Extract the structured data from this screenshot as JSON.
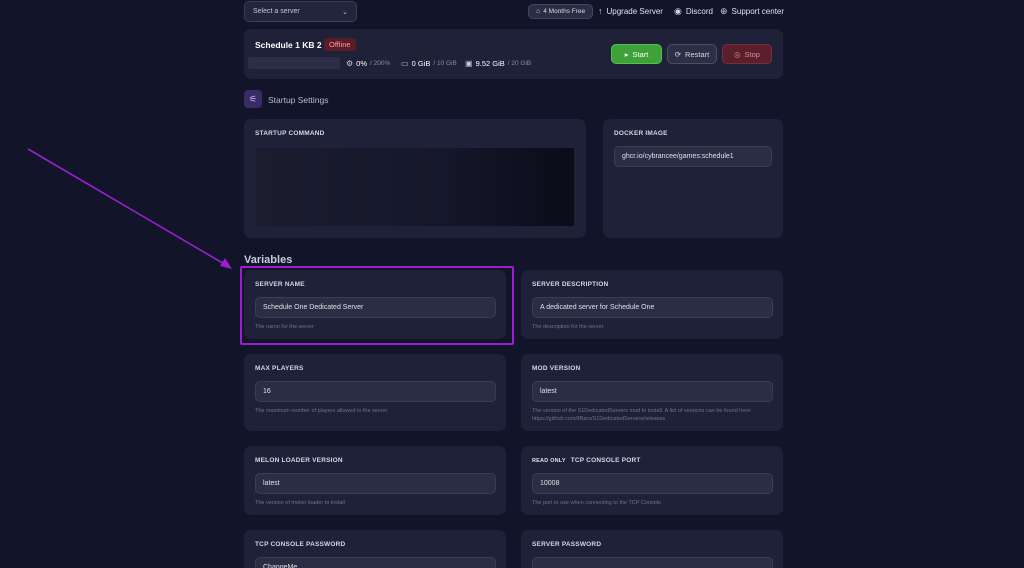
{
  "topbar": {
    "server_select_placeholder": "Select a server",
    "free_pill": "4 Months Free",
    "upgrade": "Upgrade Server",
    "discord": "Discord",
    "support": "Support center"
  },
  "status": {
    "server_name": "Schedule 1 KB 2",
    "state": "Offline",
    "cpu_value": "0%",
    "cpu_limit": "/ 200%",
    "memory_value": "0 GiB",
    "memory_limit": "/ 10 GiB",
    "disk_value": "9.52 GiB",
    "disk_limit": "/ 20 GiB",
    "start_label": "Start",
    "restart_label": "Restart",
    "stop_label": "Stop"
  },
  "startup": {
    "title": "Startup Settings",
    "command_label": "STARTUP COMMAND",
    "docker_label": "DOCKER IMAGE",
    "docker_value": "ghcr.io/cybrancee/games:schedule1"
  },
  "variables": {
    "title": "Variables",
    "server_name": {
      "label": "SERVER NAME",
      "value": "Schedule One Dedicated Server",
      "help": "The name for the server"
    },
    "server_description": {
      "label": "SERVER DESCRIPTION",
      "value": "A dedicated server for Schedule One",
      "help": "The description for the server"
    },
    "max_players": {
      "label": "MAX PLAYERS",
      "value": "16",
      "help": "The maximum number of players allowed in the server"
    },
    "mod_version": {
      "label": "MOD VERSION",
      "value": "latest",
      "help": "The version of the S1DedicatedServers mod to install. A list of versions can be found here: https://github.com/ifBars/S1DedicatedServers/releases"
    },
    "melon_loader": {
      "label": "MELON LOADER VERSION",
      "value": "latest",
      "help": "The version of melon loader to install"
    },
    "tcp_port": {
      "read_only": "READ ONLY",
      "label": "TCP CONSOLE PORT",
      "value": "10008",
      "help": "The port to use when connecting to the TCP Console"
    },
    "tcp_password": {
      "label": "TCP CONSOLE PASSWORD",
      "value": "ChangeMe"
    },
    "server_password": {
      "label": "SERVER PASSWORD",
      "value": ""
    }
  },
  "colors": {
    "background": "#12142a",
    "card": "#1e2137",
    "start": "#3fa238",
    "stop": "#5a1f2b",
    "annotation": "#9b1fd1"
  }
}
